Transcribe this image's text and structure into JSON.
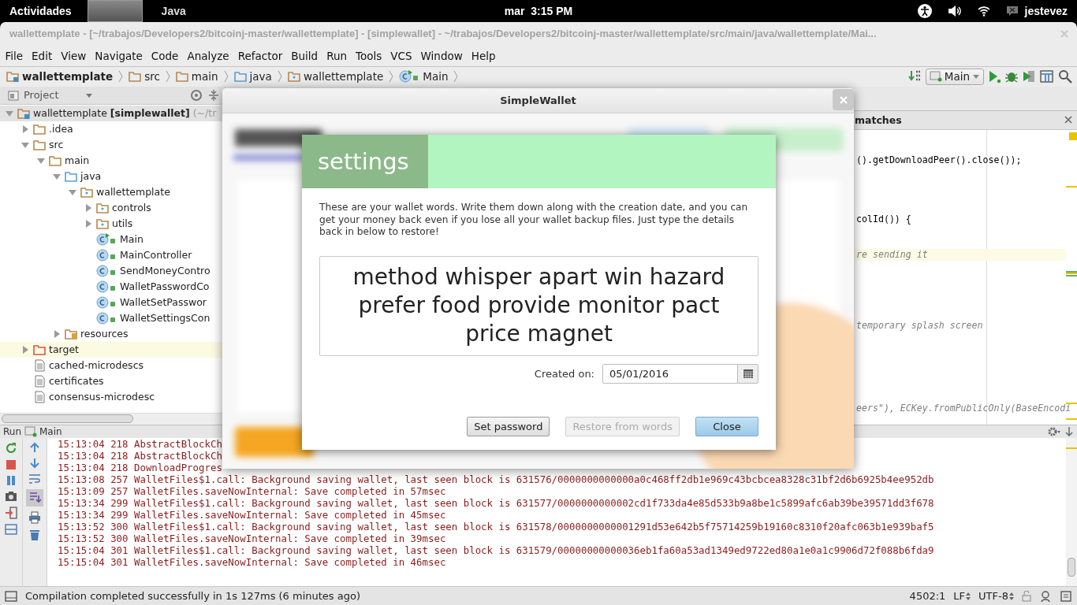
{
  "top_bar": {
    "activities": "Actividades",
    "app": "Java",
    "clock": "mar  3:15 PM",
    "user": "jestevez"
  },
  "window": {
    "title": "wallettemplate - [~/trabajos/Developers2/bitcoinj-master/wallettemplate] - [simplewallet] - ~/trabajos/Developers2/bitcoinj-master/wallettemplate/src/main/java/wallettemplate/Mai..."
  },
  "menu": [
    "File",
    "Edit",
    "View",
    "Navigate",
    "Code",
    "Analyze",
    "Refactor",
    "Build",
    "Run",
    "Tools",
    "VCS",
    "Window",
    "Help"
  ],
  "breadcrumbs": [
    {
      "label": "wallettemplate",
      "kind": "module"
    },
    {
      "label": "src",
      "kind": "folder"
    },
    {
      "label": "main",
      "kind": "folder"
    },
    {
      "label": "java",
      "kind": "source"
    },
    {
      "label": "wallettemplate",
      "kind": "package"
    },
    {
      "label": "Main",
      "kind": "main-class"
    }
  ],
  "run_config": {
    "label": "Main"
  },
  "project_panel": {
    "title": "Project",
    "tree": [
      {
        "label": "wallettemplate **[simplewallet]**",
        "hint": "(~/tr",
        "kind": "module",
        "expanded": true,
        "selected": true,
        "children": [
          {
            "label": ".idea",
            "kind": "folder",
            "expanded": false,
            "selected": false
          },
          {
            "label": "src",
            "kind": "folder",
            "expanded": true,
            "selected": false,
            "children": [
              {
                "label": "main",
                "kind": "folder",
                "expanded": true,
                "selected": false,
                "children": [
                  {
                    "label": "java",
                    "kind": "source",
                    "expanded": true,
                    "selected": false,
                    "children": [
                      {
                        "label": "wallettemplate",
                        "kind": "package",
                        "expanded": true,
                        "selected": false,
                        "children": [
                          {
                            "label": "controls",
                            "kind": "package",
                            "expanded": false,
                            "selected": false
                          },
                          {
                            "label": "utils",
                            "kind": "package",
                            "expanded": false,
                            "selected": false
                          },
                          {
                            "label": "Main",
                            "kind": "main-class",
                            "selected": false
                          },
                          {
                            "label": "MainController",
                            "kind": "class",
                            "selected": false
                          },
                          {
                            "label": "SendMoneyContro",
                            "kind": "class",
                            "selected": false
                          },
                          {
                            "label": "WalletPasswordCo",
                            "kind": "class",
                            "selected": false
                          },
                          {
                            "label": "WalletSetPasswor",
                            "kind": "class",
                            "selected": false
                          },
                          {
                            "label": "WalletSettingsCon",
                            "kind": "class",
                            "selected": false
                          }
                        ]
                      }
                    ]
                  },
                  {
                    "label": "resources",
                    "kind": "resources",
                    "expanded": false,
                    "selected": false
                  }
                ]
              }
            ]
          },
          {
            "label": "target",
            "kind": "excluded",
            "expanded": false,
            "selected": false,
            "highlighted": true
          },
          {
            "label": "cached-microdescs",
            "kind": "file",
            "selected": false
          },
          {
            "label": "certificates",
            "kind": "file",
            "selected": false
          },
          {
            "label": "consensus-microdesc",
            "kind": "file",
            "selected": false
          }
        ]
      }
    ]
  },
  "editor": {
    "find_bar": {
      "label": "matches"
    },
    "lines": [
      {
        "kind": "blank"
      },
      {
        "kind": "blank"
      },
      {
        "kind": "code",
        "text": "().getDownloadPeer().close());"
      },
      {
        "kind": "blank"
      },
      {
        "kind": "blank"
      },
      {
        "kind": "blank"
      },
      {
        "kind": "blank"
      },
      {
        "kind": "code",
        "text": "colId()) {"
      },
      {
        "kind": "blank"
      },
      {
        "kind": "blank"
      },
      {
        "kind": "comment",
        "text": "re sending it",
        "current": true
      },
      {
        "kind": "blank"
      },
      {
        "kind": "blank"
      },
      {
        "kind": "blank"
      },
      {
        "kind": "blank"
      },
      {
        "kind": "blank"
      },
      {
        "kind": "comment",
        "text": "temporary splash screen"
      },
      {
        "kind": "blank"
      },
      {
        "kind": "blank"
      },
      {
        "kind": "blank"
      },
      {
        "kind": "blank"
      },
      {
        "kind": "blank"
      },
      {
        "kind": "blank"
      },
      {
        "kind": "comment",
        "text": "eers\"), ECKey.fromPublicOnly(BaseEncodi"
      }
    ]
  },
  "simple_wallet": {
    "title": "SimpleWallet",
    "settings": {
      "heading": "settings",
      "description": "These are your wallet words. Write them down along with the creation date, and you can get your money back even if you lose all your wallet backup files. Just type the details back in below to restore!",
      "words": "method whisper apart win hazard prefer food provide monitor pact price magnet",
      "created_label": "Created on:",
      "created_value": "05/01/2016",
      "buttons": [
        {
          "label": "Set password",
          "disabled": false,
          "default": false
        },
        {
          "label": "Restore from words",
          "disabled": true,
          "default": false
        },
        {
          "label": "Close",
          "disabled": false,
          "default": true
        }
      ]
    }
  },
  "run_panel": {
    "title": "Run",
    "tab": "Main",
    "log": [
      "15:13:04 218 AbstractBlockCh",
      "15:13:04 218 AbstractBlockCh",
      "15:13:04 218 DownloadProgres",
      "15:13:08 257 WalletFiles$1.call: Background saving wallet, last seen block is 631576/0000000000000a0c468ff2db1e969c43bcbcea8328c31bf2d6b6925b4ee952db",
      "15:13:09 257 WalletFiles.saveNowInternal: Save completed in 57msec",
      "15:13:34 299 WalletFiles$1.call: Background saving wallet, last seen block is 631577/0000000000002cd1f733da4e85d533b9a8be1c5899afc6ab39be39571dd3f678",
      "15:13:34 299 WalletFiles.saveNowInternal: Save completed in 45msec",
      "15:13:52 300 WalletFiles$1.call: Background saving wallet, last seen block is 631578/0000000000001291d53e642b5f75714259b19160c8310f20afc063b1e939baf5",
      "15:13:52 300 WalletFiles.saveNowInternal: Save completed in 39msec",
      "15:15:04 301 WalletFiles$1.call: Background saving wallet, last seen block is 631579/00000000000036eb1fa60a53ad1349ed9722ed80a1e0a1c9906d72f088b6fda9",
      "15:15:04 301 WalletFiles.saveNowInternal: Save completed in 46msec"
    ]
  },
  "status_bar": {
    "message": "Compilation completed successfully in 1s 127ms (6 minutes ago)",
    "position": "4502:1",
    "line_separator": "LF",
    "encoding": "UTF-8"
  }
}
